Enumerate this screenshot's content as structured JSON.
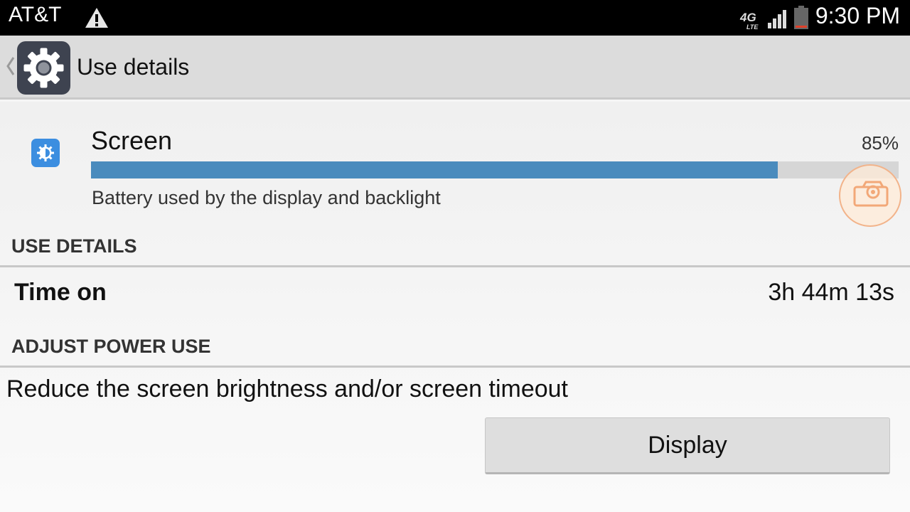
{
  "status_bar": {
    "carrier": "AT&T",
    "time": "9:30 PM",
    "network_badge": "4G LTE",
    "icons": [
      "warning-icon",
      "lte-icon",
      "signal-icon",
      "battery-icon"
    ]
  },
  "action_bar": {
    "title": "Use details",
    "app_icon": "settings-gear-icon",
    "back_icon": "chevron-left-icon"
  },
  "item": {
    "name": "Screen",
    "percent_label": "85%",
    "usage_fraction": 0.85,
    "description": "Battery used by the display and backlight",
    "icon": "brightness-icon",
    "bar_color": "#4a8bbd"
  },
  "use_details": {
    "header": "USE DETAILS",
    "rows": [
      {
        "label": "Time on",
        "value": "3h 44m 13s"
      }
    ]
  },
  "adjust_power": {
    "header": "ADJUST POWER USE",
    "advice": "Reduce the screen brightness and/or screen timeout",
    "button_label": "Display"
  },
  "overlay": {
    "icon": "screenshot-camera-icon",
    "accent_color": "#f2a878"
  }
}
